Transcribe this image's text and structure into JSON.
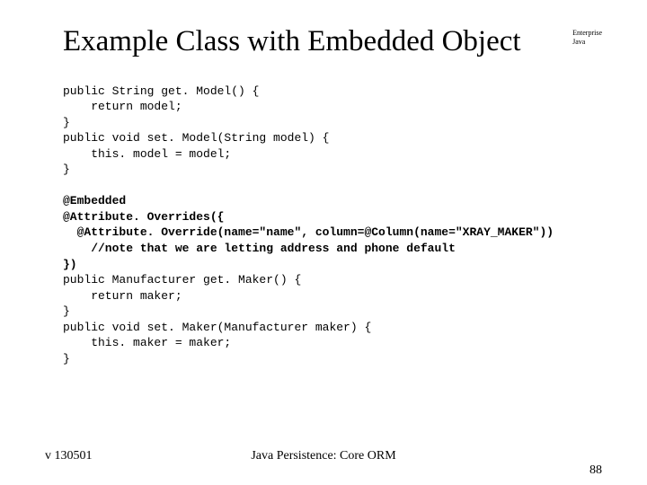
{
  "corner": {
    "line1": "Enterprise",
    "line2": "Java"
  },
  "title": "Example Class with Embedded Object",
  "code": {
    "l1": "public String get. Model() {",
    "l2": "    return model;",
    "l3": "}",
    "l4": "public void set. Model(String model) {",
    "l5": "    this. model = model;",
    "l6": "}",
    "l7": "",
    "l8": "@Embedded",
    "l9": "@Attribute. Overrides({",
    "l10": "  @Attribute. Override(name=\"name\", column=@Column(name=\"XRAY_MAKER\"))",
    "l11": "    //note that we are letting address and phone default",
    "l12": "})",
    "l13": "public Manufacturer get. Maker() {",
    "l14": "    return maker;",
    "l15": "}",
    "l16": "public void set. Maker(Manufacturer maker) {",
    "l17": "    this. maker = maker;",
    "l18": "}"
  },
  "footer": {
    "version": "v 130501",
    "center": "Java Persistence: Core ORM",
    "page": "88"
  }
}
